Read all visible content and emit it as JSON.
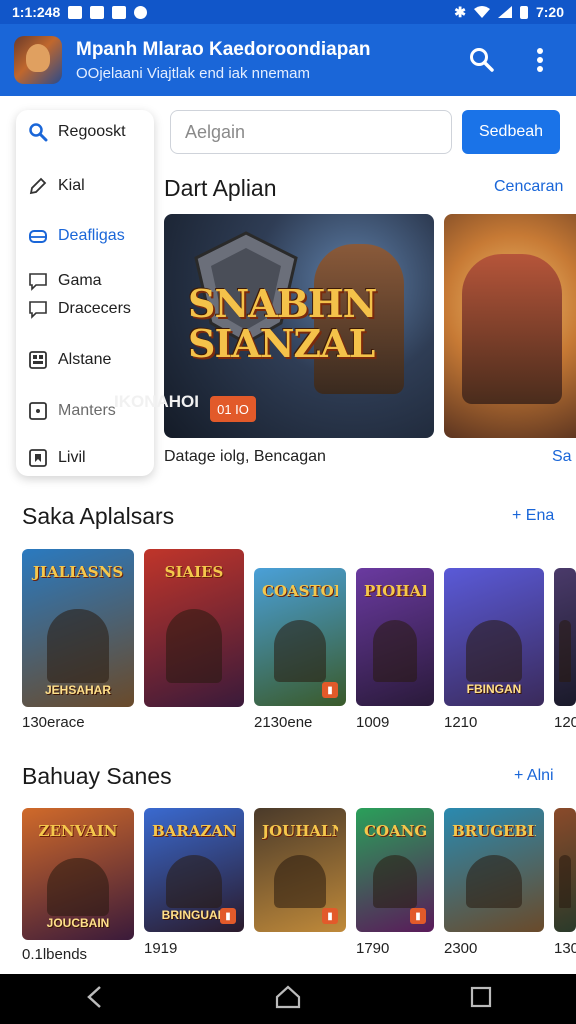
{
  "status_bar": {
    "time_left": "1:1:248",
    "time_right": "7:20"
  },
  "app_bar": {
    "title": "Mpanh Mlarao Kaedoroondiapan",
    "subtitle": "OOjelaani Viajtlak end iak nnemam"
  },
  "sidebar": {
    "items": [
      {
        "label": "Regooskt",
        "icon": "search-icon"
      },
      {
        "label": "Kial",
        "icon": "pen-icon"
      },
      {
        "label": "Deafligas",
        "icon": "gamepad-icon"
      },
      {
        "label": "Gama",
        "icon": "chat-icon"
      },
      {
        "label": "Dracecers",
        "icon": "chat-icon"
      },
      {
        "label": "Alstane",
        "icon": "grid-icon"
      },
      {
        "label": "Manters",
        "icon": "square-icon"
      },
      {
        "label": "Livil",
        "icon": "bookmark-icon"
      }
    ]
  },
  "search": {
    "placeholder": "Aelgain",
    "button_label": "Sedbeah"
  },
  "featured": {
    "title": "Dart Aplian",
    "link": "Cencaran",
    "banner_logo_1": "SNABHN",
    "banner_logo_2": "SIANZAL",
    "banner_caption": "IKONAHOI",
    "banner_badge": "01 IO",
    "banner_text": "Datage iolg, Bencagan",
    "banner_text_2": "Sa"
  },
  "section_1": {
    "title": "Saka Aplalsars",
    "link": "+ Ena",
    "cards": [
      {
        "title": "JIALIASNS",
        "subtitle": "JEHSAHAR",
        "label": "130erace",
        "colors": [
          "#2a7ac0",
          "#6a4a2a"
        ]
      },
      {
        "title": "SIAIES",
        "subtitle": "",
        "label": "",
        "colors": [
          "#c0352a",
          "#3a1a3a"
        ]
      },
      {
        "title": "COASTORE",
        "subtitle": "",
        "label": "2130ene",
        "colors": [
          "#4aa0d8",
          "#3a5a2a"
        ]
      },
      {
        "title": "PIOHAHKY",
        "subtitle": "",
        "label": "1009",
        "colors": [
          "#6a3aa0",
          "#2a1a3a"
        ]
      },
      {
        "title": "",
        "subtitle": "FBINGAN",
        "label": "1210",
        "colors": [
          "#5a5ad8",
          "#3a2a5a"
        ]
      },
      {
        "title": "",
        "subtitle": "",
        "label": "120",
        "colors": [
          "#4a3a6a",
          "#1a1a2a"
        ]
      }
    ]
  },
  "section_2": {
    "title": "Bahuay Sanes",
    "link": "+ Alni",
    "cards": [
      {
        "title": "ZENVAIN",
        "subtitle": "JOUCBAIN",
        "label": "0.1lbends",
        "colors": [
          "#d06a2a",
          "#3a1a3a"
        ]
      },
      {
        "title": "BARAZAN",
        "subtitle": "BRINGUAK",
        "label": "1919",
        "colors": [
          "#3a6ad0",
          "#2a1a2a"
        ]
      },
      {
        "title": "JOUHALNS",
        "subtitle": "",
        "label": "",
        "colors": [
          "#4a3a2a",
          "#c08a3a"
        ]
      },
      {
        "title": "COANGASA",
        "subtitle": "",
        "label": "1790",
        "colors": [
          "#2aa05a",
          "#5a1a5a"
        ]
      },
      {
        "title": "BRUGEBIN",
        "subtitle": "",
        "label": "2300",
        "colors": [
          "#2a8ab0",
          "#6a4a2a"
        ]
      },
      {
        "title": "",
        "subtitle": "",
        "label": "130",
        "colors": [
          "#8a4a2a",
          "#2a3a2a"
        ]
      }
    ]
  }
}
